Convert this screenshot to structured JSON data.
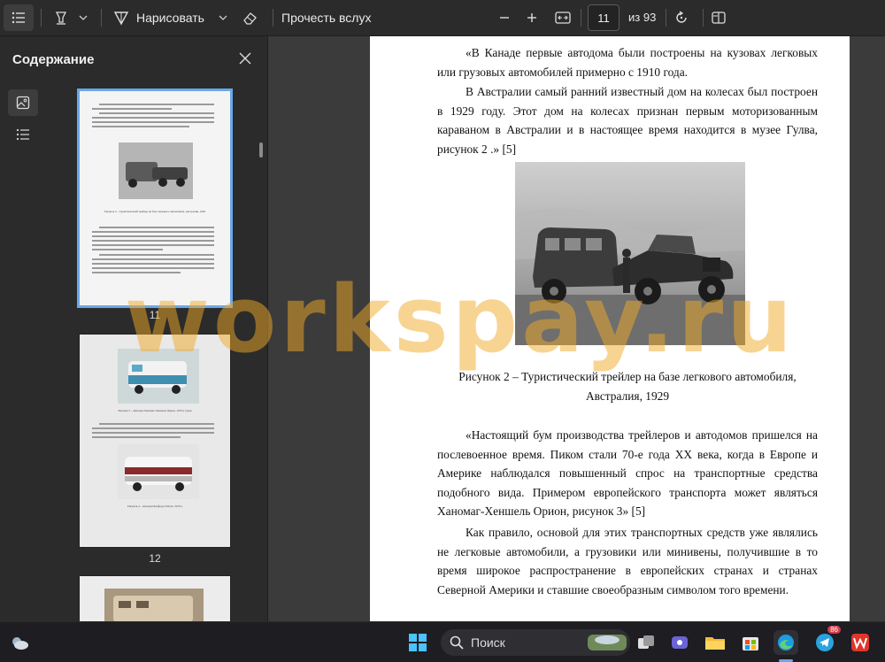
{
  "toolbar": {
    "draw_label": "Нарисовать",
    "read_aloud_label": "Прочесть вслух",
    "current_page": "11",
    "total_pages": "из 93"
  },
  "sidebar": {
    "title": "Содержание",
    "thumbnails": [
      {
        "page_label": "11",
        "caption": "Рисунок 2 – Туристический трейлер на базе легкового автомобиля, Австралия, 1929"
      },
      {
        "page_label": "12",
        "captions": [
          "Рисунок 3 – Автодом Хеномаг-Хеншель Орион, 1970-х годов",
          "Рисунок 4 – Автодом Бедфорд Тойота, 1970-х"
        ]
      }
    ]
  },
  "document": {
    "paragraphs": [
      "«В Канаде первые автодома были построены на кузовах легковых или грузовых автомобилей примерно с 1910 года.",
      "В Австралии самый ранний известный дом на колесах был построен в 1929 году. Этот дом на колесах признан первым моторизованным караваном в Австралии и в настоящее время находится в музее Гулва, рисунок 2 .» [5]",
      "«Настоящий бум производства трейлеров и автодомов пришелся на послевоенное время. Пиком стали 70-е года XX века, когда в Европе и Америке наблюдался повышенный спрос на транспортные средства подобного вида. Примером европейского транспорта может являться Ханомаг-Хеншель Орион, рисунок 3» [5]",
      "Как правило, основой для этих транспортных средств уже являлись не легковые автомобили, а грузовики или минивены, получившие в то время широкое распространение в европейских странах и странах Северной Америки и ставшие своеобразным символом того времени."
    ],
    "figure_caption_line1": "Рисунок 2 – Туристический трейлер на базе легкового автомобиля,",
    "figure_caption_line2": "Австралия, 1929"
  },
  "watermark": "workspay.ru",
  "taskbar": {
    "search_label": "Поиск",
    "telegram_badge": "86"
  },
  "colors": {
    "accent": "#6aa7e8",
    "toolbar_bg": "#2b2b2b",
    "canvas_bg": "#3b3b3b",
    "watermark": "#f2aa28"
  },
  "icons": [
    "contents-icon",
    "highlighter-icon",
    "chevron-down-icon",
    "draw-icon",
    "eraser-icon",
    "zoom-out-icon",
    "zoom-in-icon",
    "fit-width-icon",
    "rotate-icon",
    "page-view-icon",
    "close-icon",
    "image-icon",
    "list-icon",
    "weather-icon",
    "windows-icon",
    "search-icon",
    "edge-icon",
    "explorer-icon",
    "store-icon",
    "telegram-icon"
  ]
}
